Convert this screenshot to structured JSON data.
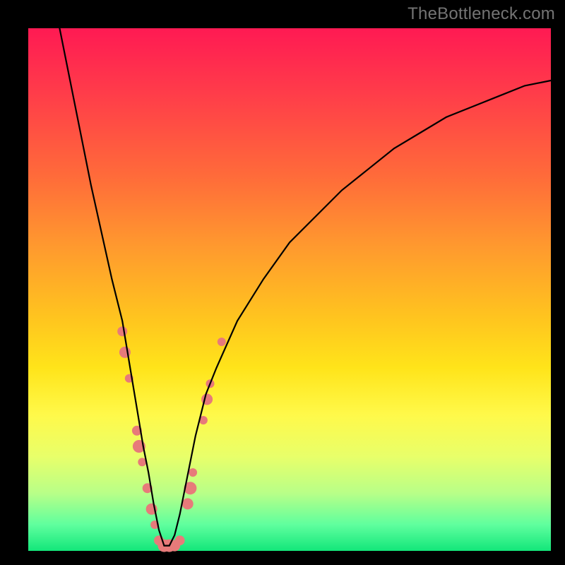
{
  "watermark": "TheBottleneck.com",
  "colors": {
    "frame_bg": "#000000",
    "watermark_text": "#747474",
    "curve_stroke": "#000000",
    "marker_fill": "#e77a7a",
    "gradient_stops": [
      "#ff1a53",
      "#ff3b4a",
      "#ff6a3a",
      "#ff9a2e",
      "#ffc31f",
      "#ffe41a",
      "#fff94a",
      "#e8ff6a",
      "#b8ff88",
      "#5fff9e",
      "#13e67a"
    ]
  },
  "chart_data": {
    "type": "line",
    "title": "",
    "xlabel": "",
    "ylabel": "",
    "xlim": [
      0,
      100
    ],
    "ylim": [
      0,
      100
    ],
    "grid": false,
    "note": "x in percent across plot width (0=left,100=right); y in percent of plot height (0=bottom/green,100=top/red). Curve is a skewed V with minimum near x≈26, y≈0.",
    "series": [
      {
        "name": "bottleneck-curve",
        "x": [
          6,
          8,
          10,
          12,
          14,
          16,
          18,
          20,
          21,
          22,
          23,
          24,
          25,
          26,
          27,
          28,
          29,
          30,
          31,
          32,
          34,
          36,
          40,
          45,
          50,
          55,
          60,
          65,
          70,
          75,
          80,
          85,
          90,
          95,
          100
        ],
        "y": [
          100,
          90,
          80,
          70,
          61,
          52,
          44,
          32,
          26,
          20,
          15,
          9,
          4,
          1,
          1,
          3,
          7,
          12,
          17,
          22,
          30,
          35,
          44,
          52,
          59,
          64,
          69,
          73,
          77,
          80,
          83,
          85,
          87,
          89,
          90
        ]
      }
    ],
    "markers": {
      "name": "sample-points",
      "comment": "salmon dot clusters along the lower part of the V",
      "points": [
        {
          "x": 18.0,
          "y": 42,
          "r": 7
        },
        {
          "x": 18.5,
          "y": 38,
          "r": 8
        },
        {
          "x": 19.3,
          "y": 33,
          "r": 6
        },
        {
          "x": 20.8,
          "y": 23,
          "r": 7
        },
        {
          "x": 21.2,
          "y": 20,
          "r": 9
        },
        {
          "x": 21.8,
          "y": 17,
          "r": 6
        },
        {
          "x": 22.8,
          "y": 12,
          "r": 7
        },
        {
          "x": 23.6,
          "y": 8,
          "r": 8
        },
        {
          "x": 24.2,
          "y": 5,
          "r": 6
        },
        {
          "x": 25.0,
          "y": 2,
          "r": 7
        },
        {
          "x": 26.0,
          "y": 1,
          "r": 9
        },
        {
          "x": 27.0,
          "y": 1,
          "r": 9
        },
        {
          "x": 28.0,
          "y": 1,
          "r": 8
        },
        {
          "x": 29.0,
          "y": 2,
          "r": 7
        },
        {
          "x": 30.5,
          "y": 9,
          "r": 8
        },
        {
          "x": 31.0,
          "y": 12,
          "r": 9
        },
        {
          "x": 31.5,
          "y": 15,
          "r": 6
        },
        {
          "x": 33.5,
          "y": 25,
          "r": 6
        },
        {
          "x": 34.2,
          "y": 29,
          "r": 8
        },
        {
          "x": 34.8,
          "y": 32,
          "r": 6
        },
        {
          "x": 37.0,
          "y": 40,
          "r": 6
        }
      ]
    }
  }
}
